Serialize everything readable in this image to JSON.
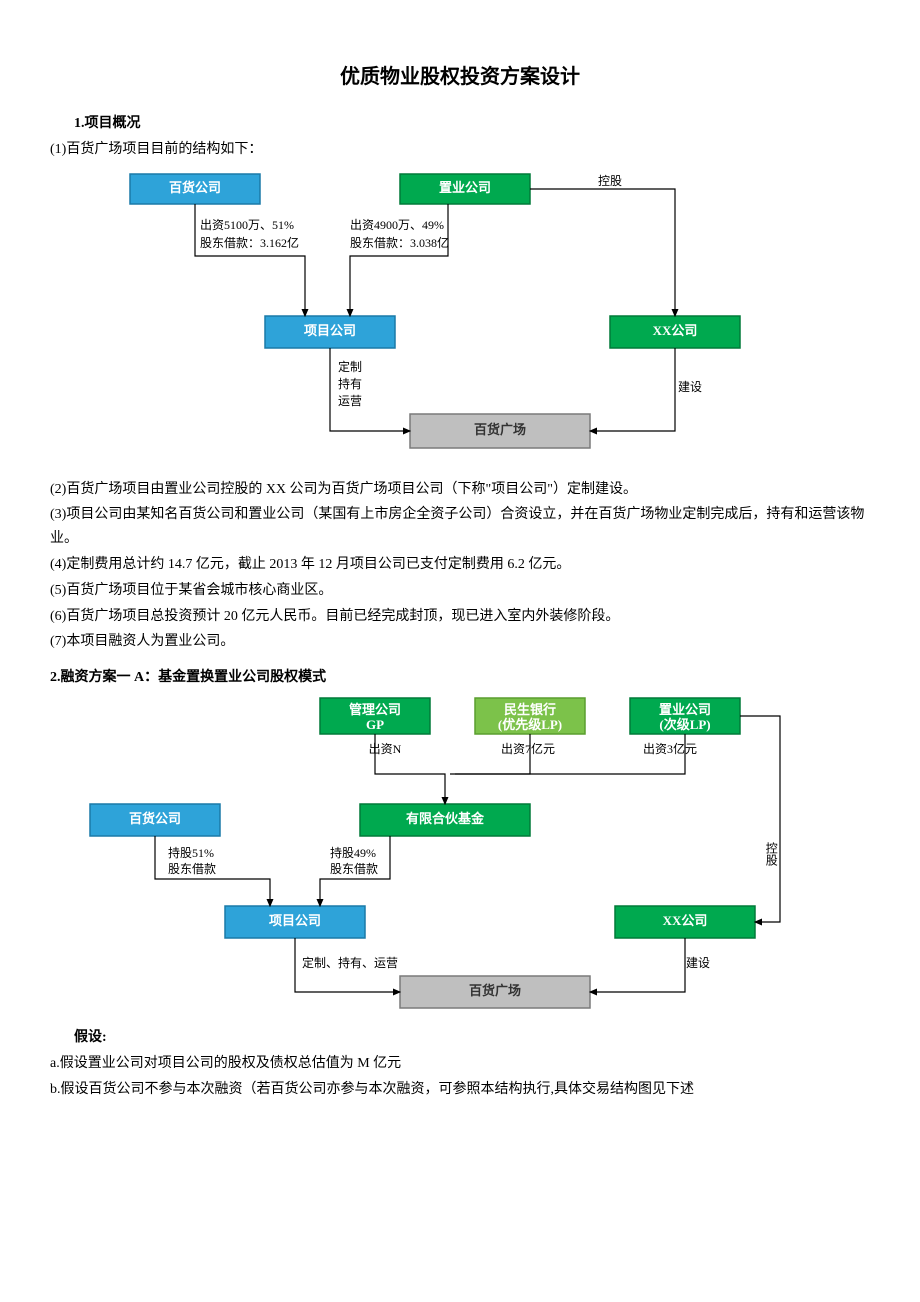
{
  "title": "优质物业股权投资方案设计",
  "s1": {
    "heading": "1.项目概况",
    "p1": "(1)百货广场项目目前的结构如下：",
    "d1": {
      "box_bh": "百货公司",
      "box_zy": "置业公司",
      "box_proj": "项目公司",
      "box_xx": "XX公司",
      "box_plaza": "百货广场",
      "lab_l1": "出资5100万、51%",
      "lab_l2": "股东借款：3.162亿",
      "lab_r1": "出资4900万、49%",
      "lab_r2": "股东借款：3.038亿",
      "lab_kg": "控股",
      "lab_dz": "定制",
      "lab_cy": "持有",
      "lab_yy": "运营",
      "lab_js": "建设"
    },
    "p2": "(2)百货广场项目由置业公司控股的 XX 公司为百货广场项目公司（下称\"项目公司\"）定制建设。",
    "p3": "(3)项目公司由某知名百货公司和置业公司（某国有上市房企全资子公司）合资设立，并在百货广场物业定制完成后，持有和运营该物业。",
    "p4": "(4)定制费用总计约 14.7 亿元，截止 2013 年 12 月项目公司已支付定制费用 6.2 亿元。",
    "p5": "(5)百货广场项目位于某省会城市核心商业区。",
    "p6": "(6)百货广场项目总投资预计 20 亿元人民币。目前已经完成封顶，现已进入室内外装修阶段。",
    "p7": "(7)本项目融资人为置业公司。"
  },
  "s2": {
    "heading": "2.融资方案一 A：基金置换置业公司股权模式",
    "d2": {
      "box_gp1": "管理公司",
      "box_gp2": "GP",
      "box_ms1": "民生银行",
      "box_ms2": "(优先级LP)",
      "box_zy1": "置业公司",
      "box_zy2": "(次级LP)",
      "box_bh": "百货公司",
      "box_fund": "有限合伙基金",
      "box_proj": "项目公司",
      "box_xx": "XX公司",
      "box_plaza": "百货广场",
      "lab_czn": "出资N",
      "lab_cz7": "出资7亿元",
      "lab_cz3": "出资3亿元",
      "lab_cg51": "持股51%",
      "lab_jk1": "股东借款",
      "lab_cg49": "持股49%",
      "lab_jk2": "股东借款",
      "lab_kg": "控股",
      "lab_dzcy": "定制、持有、运营",
      "lab_js": "建设"
    },
    "assume_h": "假设:",
    "a1": "a.假设置业公司对项目公司的股权及债权总估值为 M 亿元",
    "a2": "b.假设百货公司不参与本次融资（若百货公司亦参与本次融资，可参照本结构执行,具体交易结构图见下述"
  }
}
